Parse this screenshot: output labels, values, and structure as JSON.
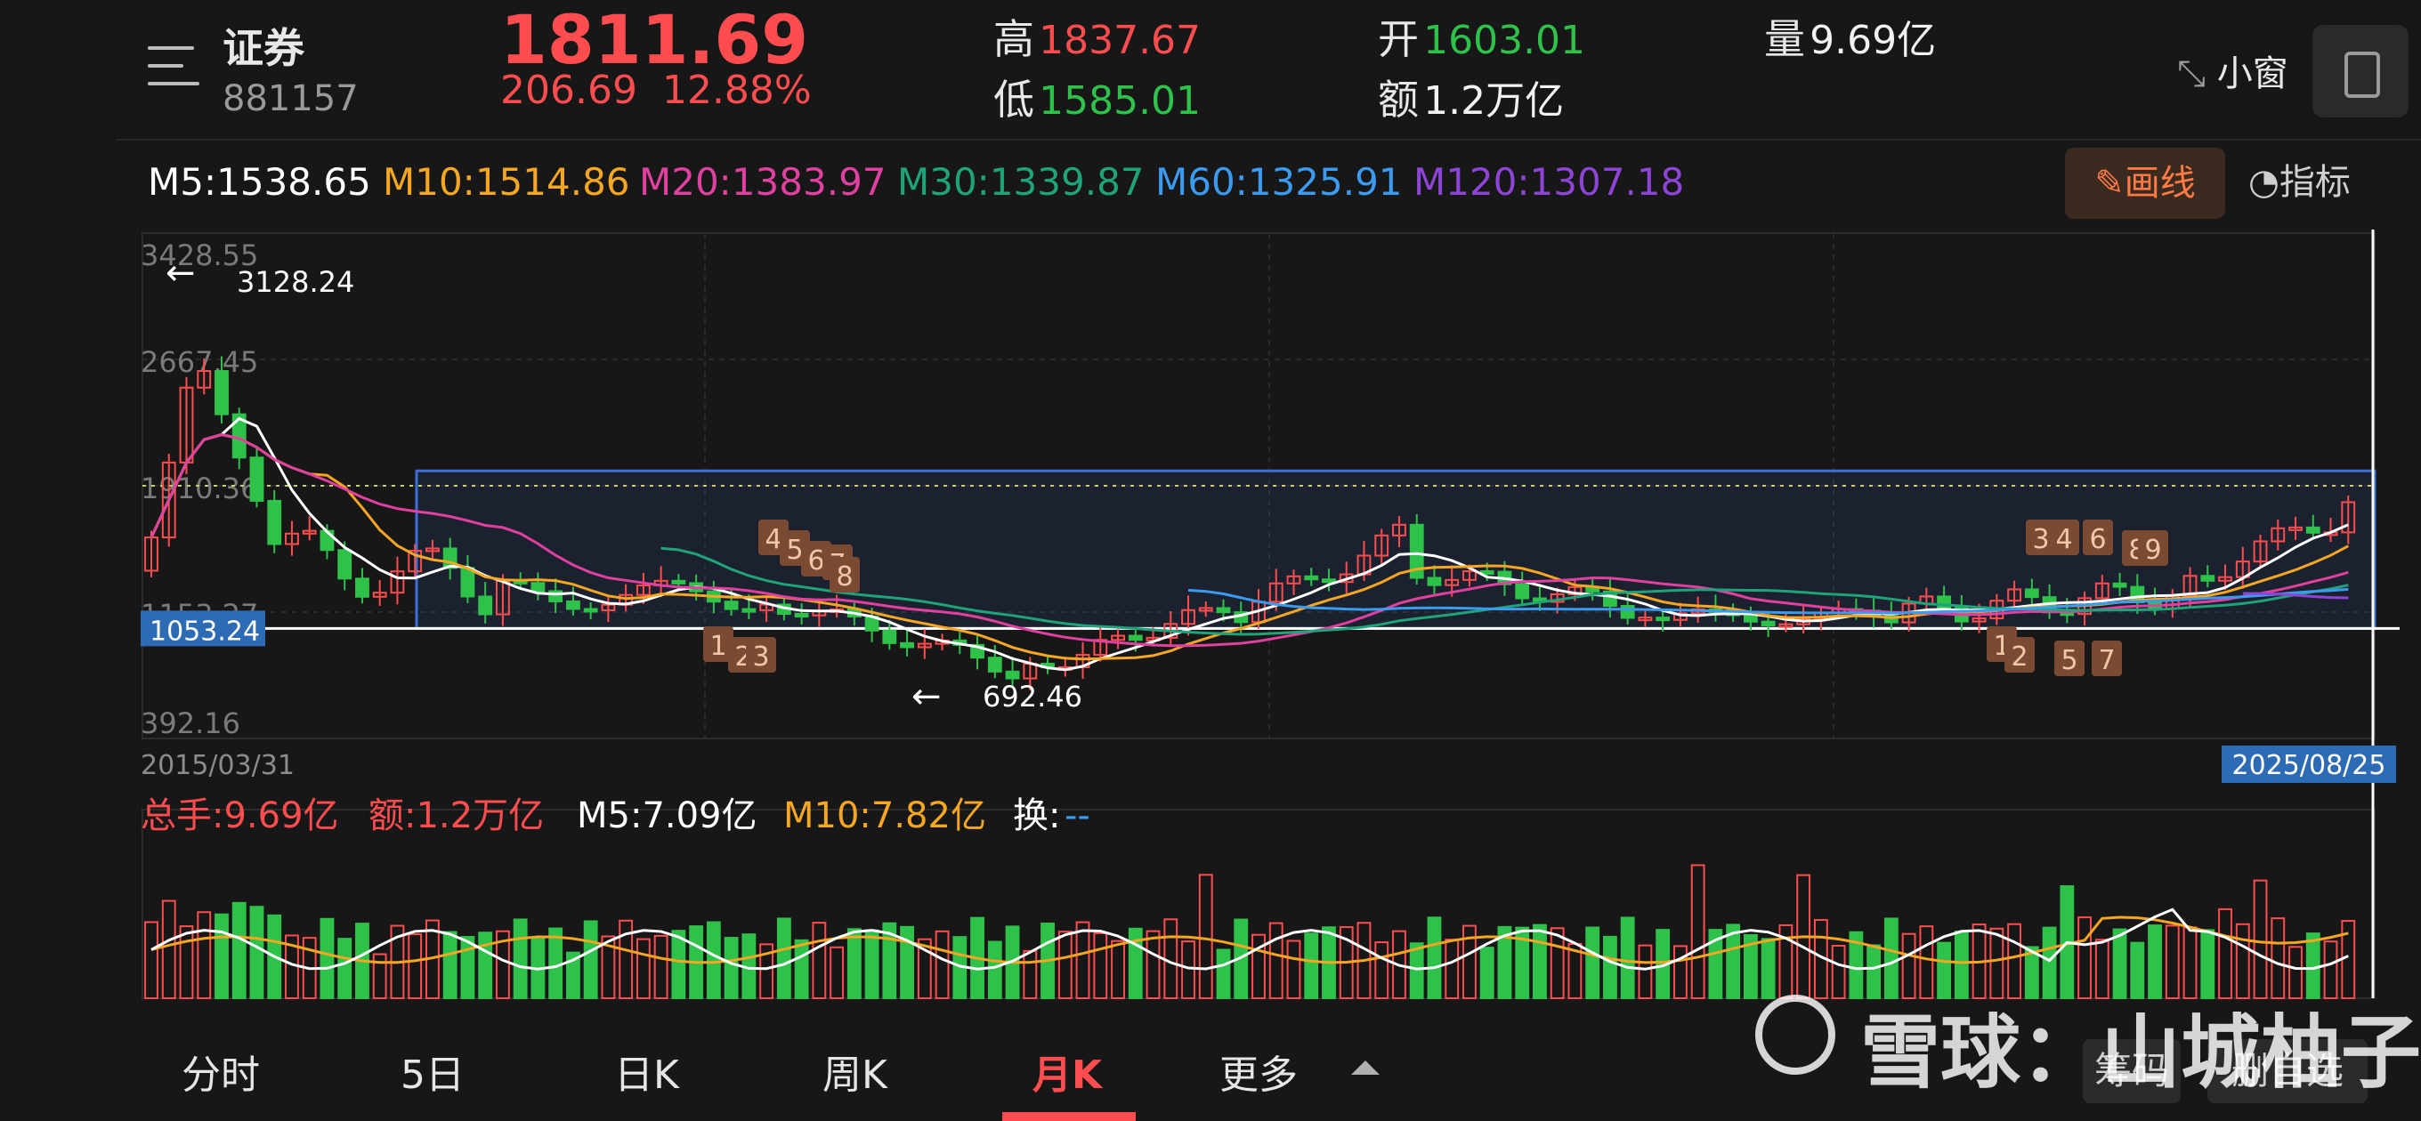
{
  "header": {
    "name": "证券",
    "code": "881157",
    "price": "1811.69",
    "change": "206.69",
    "change_pct": "12.88%",
    "high_label": "高",
    "high": "1837.67",
    "low_label": "低",
    "low": "1585.01",
    "open_label": "开",
    "open": "1603.01",
    "amount_label": "额",
    "amount": "1.2万亿",
    "volume_label": "量",
    "volume": "9.69亿",
    "mini_window": "小窗"
  },
  "ma": {
    "m5": "M5:1538.65",
    "m10": "M10:1514.86",
    "m20": "M20:1383.97",
    "m30": "M30:1339.87",
    "m60": "M60:1325.91",
    "m120": "M120:1307.18",
    "draw_btn": "画线",
    "indicator_btn": "指标"
  },
  "colors": {
    "up": "#ff4d4f",
    "down": "#2fc24b",
    "ma5": "#ffffff",
    "ma10": "#f5a623",
    "ma20": "#e040a0",
    "ma30": "#1fa37a",
    "ma60": "#3a9bf0",
    "ma120": "#8e44d6",
    "box": "#3d6fd8"
  },
  "chart_data": {
    "type": "candlestick",
    "y_ticks": [
      "3428.55",
      "2667.45",
      "1910.36",
      "1153.27",
      "392.16"
    ],
    "start_date": "2015/03/31",
    "end_date": "2025/08/25",
    "max_label": "3128.24",
    "min_label": "692.46",
    "level_label": "1053.24",
    "markers_top": [
      "4",
      "5",
      "6",
      "7",
      "8",
      "3",
      "4",
      "6",
      "8",
      "9"
    ],
    "markers_bottom": [
      "1",
      "2",
      "3",
      "1",
      "2",
      "5",
      "7"
    ],
    "volume_info": {
      "total": "总手:9.69亿",
      "amount": "额:1.2万亿",
      "m5": "M5:7.09亿",
      "m10": "M10:7.82亿",
      "turnover_label": "换:",
      "turnover": "--"
    }
  },
  "tabs": [
    {
      "label": "分时"
    },
    {
      "label": "5日"
    },
    {
      "label": "日K"
    },
    {
      "label": "周K"
    },
    {
      "label": "月K"
    },
    {
      "label": "更多"
    }
  ],
  "watermark": "雪球：山城柚子",
  "bottom_buttons": {
    "chip": "筹码",
    "remove_watch": "删自选"
  }
}
